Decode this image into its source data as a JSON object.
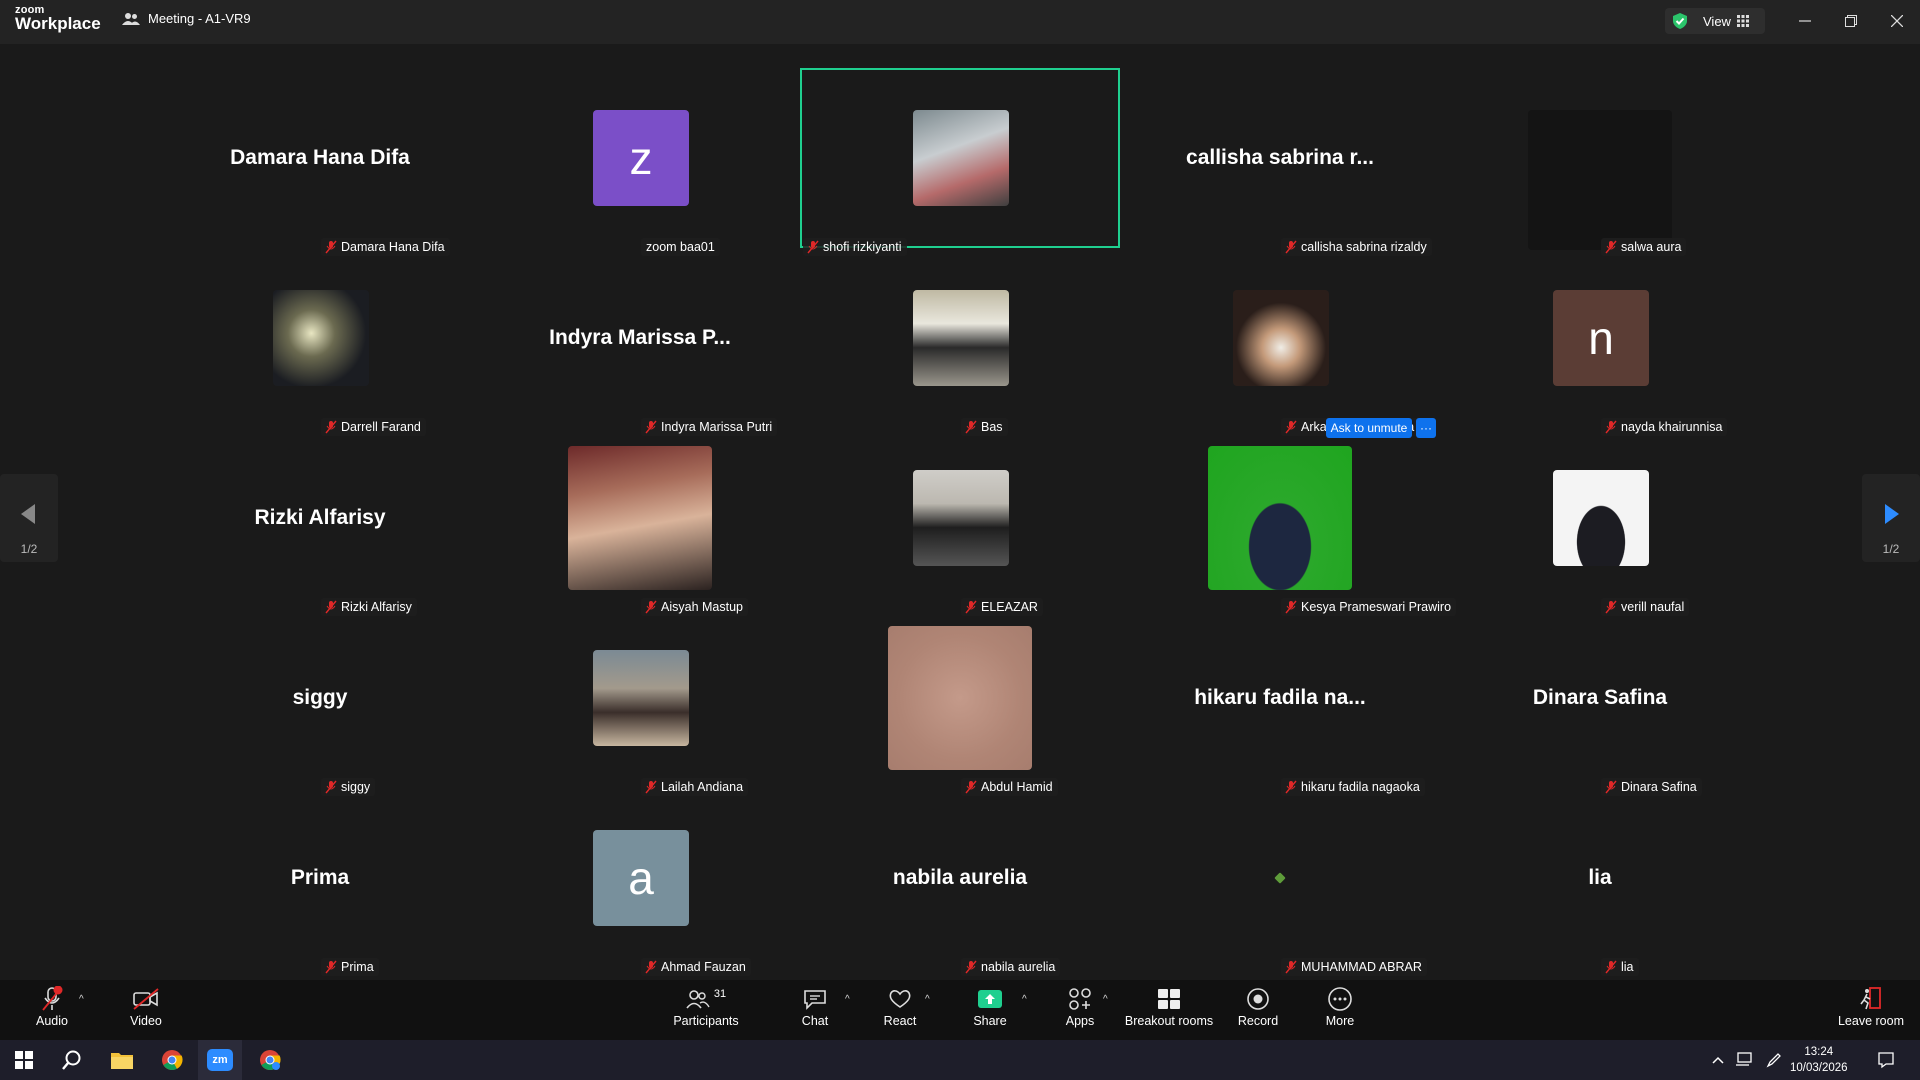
{
  "app": {
    "brand_top": "zoom",
    "brand_bottom": "Workplace",
    "meeting_title": "Meeting - A1-VR9",
    "view_label": "View"
  },
  "colors": {
    "accent_green": "#1fcf8f",
    "accent_blue": "#0e72ed",
    "mute_red": "#e02828"
  },
  "tiles": [
    {
      "title": "Damara Hana Difa",
      "label": "Damara Hana Difa"
    },
    {
      "avatar_letter": "z",
      "label": "zoom baa01"
    },
    {
      "label": "shofi rizkiyanti",
      "active": true
    },
    {
      "title": "callisha sabrina r...",
      "label": "callisha sabrina rizaldy"
    },
    {
      "label": "salwa aura"
    },
    {
      "label": "Darrell Farand"
    },
    {
      "title": "Indyra Marissa P...",
      "label": "Indyra Marissa Putri"
    },
    {
      "label": "Bas"
    },
    {
      "label": "Arkanantha Kusuma"
    },
    {
      "avatar_letter": "n",
      "label": "nayda khairunnisa"
    },
    {
      "title": "Rizki Alfarisy",
      "label": "Rizki Alfarisy"
    },
    {
      "label": "Aisyah Mastup"
    },
    {
      "label": "ELEAZAR"
    },
    {
      "label": "Kesya Prameswari Prawiro",
      "ask_label": "Ask to unmute",
      "more_label": "···"
    },
    {
      "label": "verill naufal"
    },
    {
      "title": "siggy",
      "label": "siggy"
    },
    {
      "label": "Lailah Andiana"
    },
    {
      "label": "Abdul Hamid"
    },
    {
      "title": "hikaru fadila na...",
      "label": "hikaru fadila nagaoka"
    },
    {
      "title": "Dinara Safina",
      "label": "Dinara Safina"
    },
    {
      "title": "Prima",
      "label": "Prima"
    },
    {
      "avatar_letter": "a",
      "label": "Ahmad Fauzan"
    },
    {
      "title": "nabila aurelia",
      "label": "nabila aurelia"
    },
    {
      "label": "MUHAMMAD ABRAR"
    },
    {
      "title": "lia",
      "label": "lia"
    }
  ],
  "pagination": {
    "left": "1/2",
    "right": "1/2"
  },
  "toolbar": {
    "audio": "Audio",
    "video": "Video",
    "participants": "Participants",
    "participant_count": "31",
    "chat": "Chat",
    "react": "React",
    "share": "Share",
    "apps": "Apps",
    "breakout": "Breakout rooms",
    "record": "Record",
    "more": "More",
    "leave": "Leave room"
  },
  "taskbar": {
    "time": "13:24",
    "date": "10/03/2026",
    "zoom_icon_text": "zm"
  }
}
